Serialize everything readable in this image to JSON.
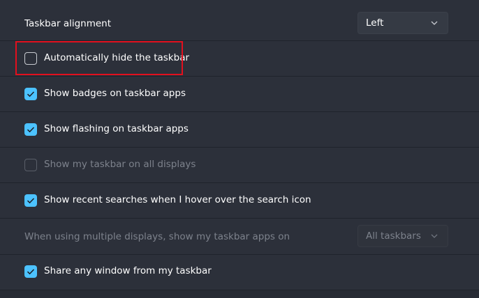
{
  "settings": {
    "alignment": {
      "label": "Taskbar alignment",
      "value": "Left"
    },
    "auto_hide": {
      "label": "Automatically hide the taskbar",
      "checked": false
    },
    "badges": {
      "label": "Show badges on taskbar apps",
      "checked": true
    },
    "flashing": {
      "label": "Show flashing on taskbar apps",
      "checked": true
    },
    "all_displays": {
      "label": "Show my taskbar on all displays",
      "checked": false,
      "disabled": true
    },
    "recent_searches": {
      "label": "Show recent searches when I hover over the search icon",
      "checked": true
    },
    "multi_display": {
      "label": "When using multiple displays, show my taskbar apps on",
      "value": "All taskbars",
      "disabled": true
    },
    "share_window": {
      "label": "Share any window from my taskbar",
      "checked": true
    }
  },
  "colors": {
    "accent": "#4cc2ff",
    "highlight": "#e2101e",
    "background": "#272b34"
  }
}
